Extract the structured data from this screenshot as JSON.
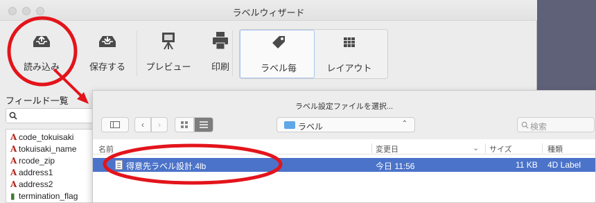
{
  "window": {
    "title": "ラベルウィザード"
  },
  "toolbar": {
    "items": [
      {
        "label": "読み込み",
        "icon": "tray-upload-icon"
      },
      {
        "label": "保存する",
        "icon": "tray-download-icon"
      },
      {
        "label": "プレビュー",
        "icon": "preview-easel-icon"
      },
      {
        "label": "印刷",
        "icon": "printer-icon"
      },
      {
        "label": "ラベル毎",
        "icon": "tag-icon",
        "selected": true
      },
      {
        "label": "レイアウト",
        "icon": "grid-layout-icon"
      }
    ]
  },
  "sidebar": {
    "title": "フィールド一覧",
    "fields": [
      "code_tokuisaki",
      "tokuisaki_name",
      "rcode_zip",
      "address1",
      "address2",
      "termination_flag"
    ]
  },
  "open_dialog": {
    "title": "ラベル設定ファイルを選択...",
    "location": "ラベル",
    "search_placeholder": "検索",
    "columns": {
      "name": "名前",
      "modified": "変更日",
      "size": "サイズ",
      "kind": "種類"
    },
    "files": [
      {
        "name": "得意先ラベル設計.4lb",
        "modified": "今日 11:56",
        "size": "11 KB",
        "kind": "4D Label"
      }
    ]
  },
  "annotation": {
    "color": "#e3141b"
  }
}
